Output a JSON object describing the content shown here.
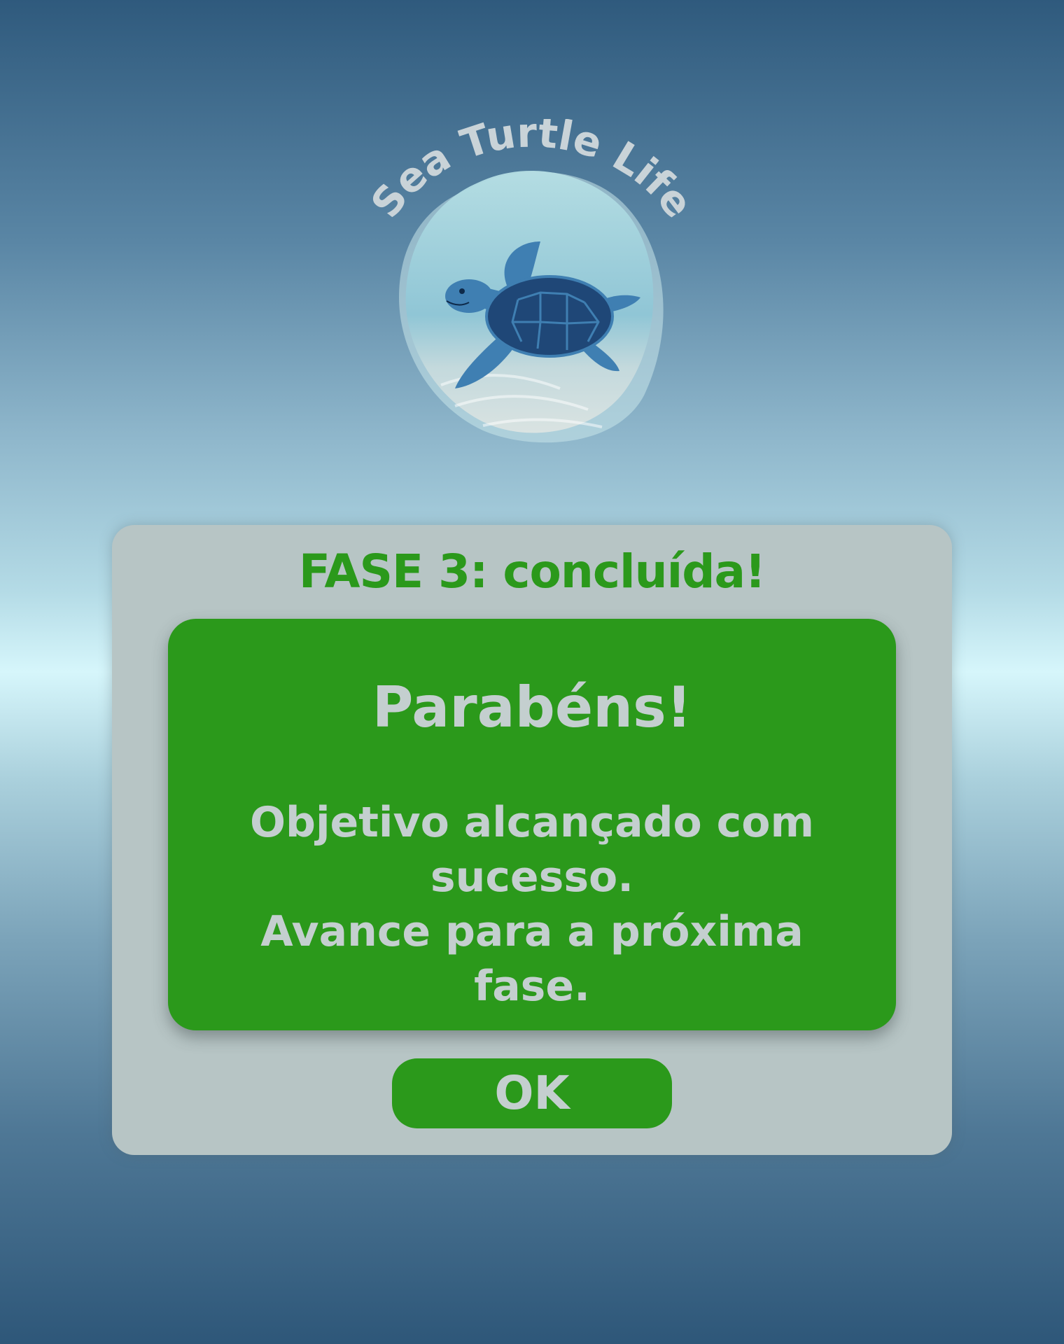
{
  "logo": {
    "title": "Sea Turtle Life",
    "icon": "sea-turtle-icon"
  },
  "dialog": {
    "phase_title": "FASE 3: concluída!",
    "heading": "Parabéns!",
    "body_line1": "Objetivo alcançado com",
    "body_line2": "sucesso.",
    "body_line3": "Avance para a próxima fase.",
    "ok_label": "OK"
  },
  "colors": {
    "accent_green": "#2b991b",
    "panel_gray": "#b7c5c5",
    "text_light": "#c4cfcf",
    "turtle_shell": "#1f4777",
    "turtle_skin": "#3f7fb2"
  }
}
